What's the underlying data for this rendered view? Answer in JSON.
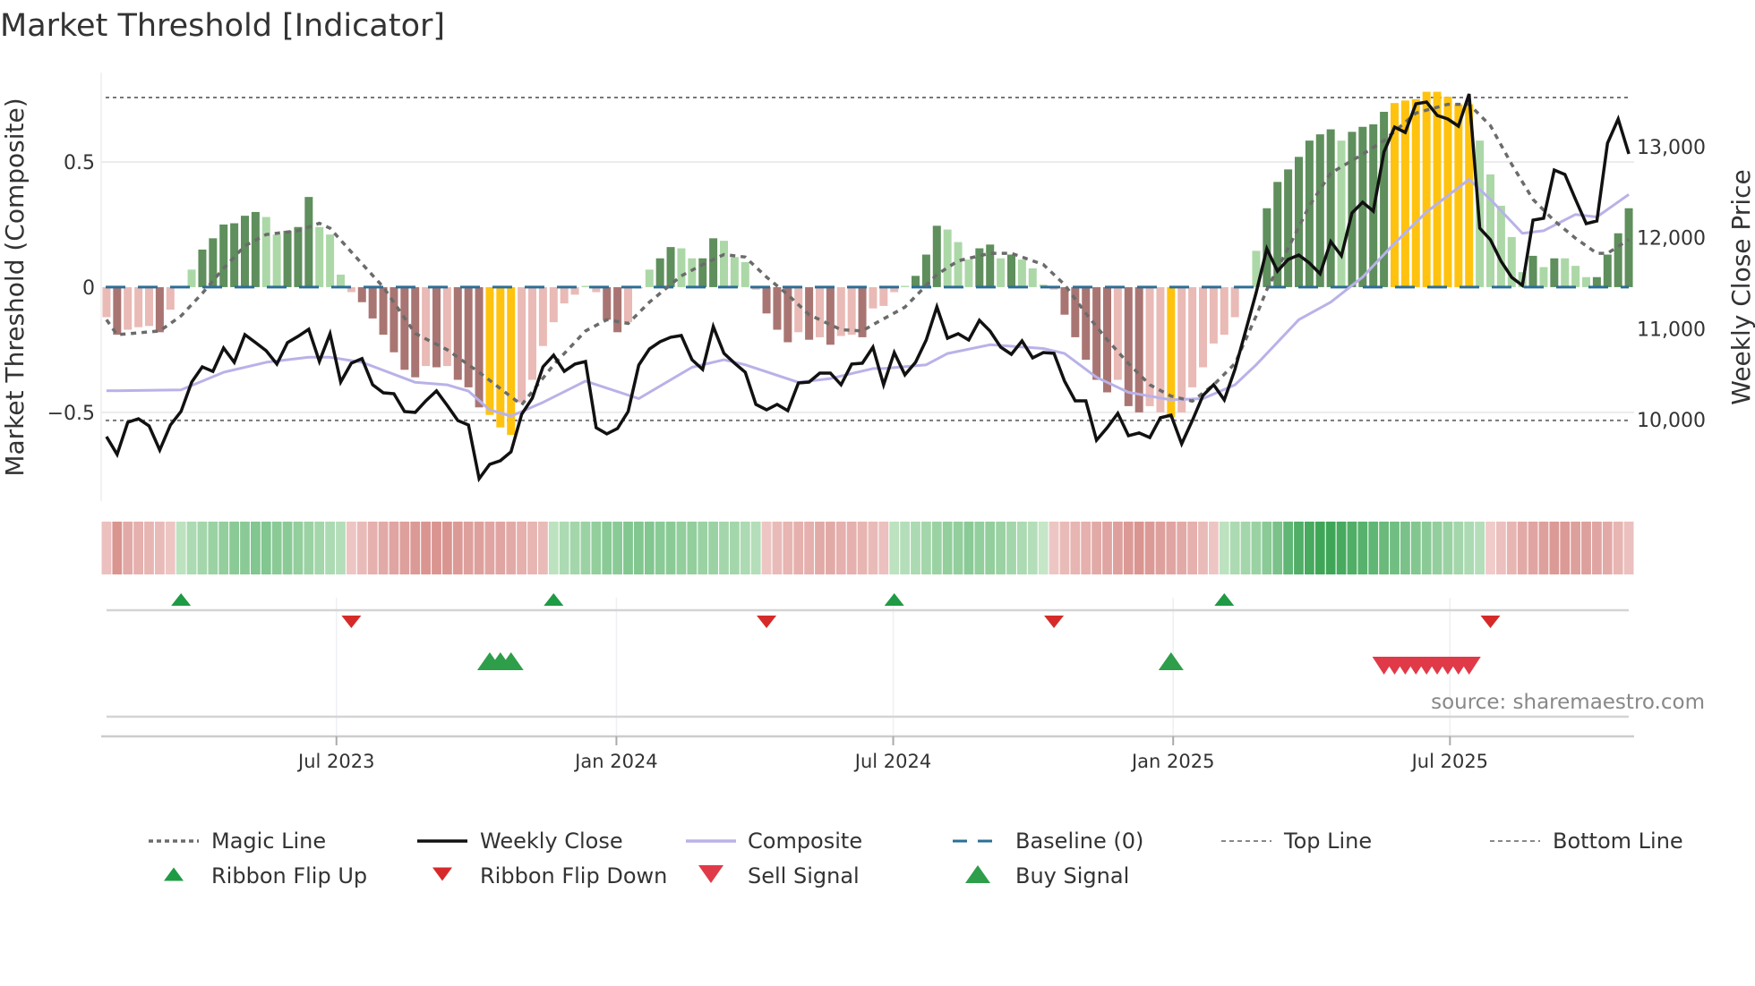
{
  "chart_data": {
    "type": "bar",
    "title": "Market Threshold [Indicator]",
    "ylabel": "Market Threshold (Composite)",
    "ylabel_right": "Weekly Close Price",
    "ylim": [
      -0.854,
      0.857
    ],
    "ylim_right": [
      9105,
      13815
    ],
    "xlim_weeks": [
      -0.5,
      143.5
    ],
    "top_line": 0.757,
    "bottom_line": -0.532,
    "baseline": 0,
    "yticks": [
      {
        "label": "0.5",
        "value": 0.5
      },
      {
        "label": "0",
        "value": 0
      },
      {
        "label": "−0.5",
        "value": -0.5
      }
    ],
    "yticks_right": [
      {
        "label": "13,000",
        "value": 13000
      },
      {
        "label": "12,000",
        "value": 12000
      },
      {
        "label": "11,000",
        "value": 11000
      },
      {
        "label": "10,000",
        "value": 10000
      }
    ],
    "xticks": [
      {
        "label": "Jul 2023",
        "week": 21.6
      },
      {
        "label": "Jan 2024",
        "week": 47.9
      },
      {
        "label": "Jul 2024",
        "week": 73.9
      },
      {
        "label": "Jan 2025",
        "week": 100.2
      },
      {
        "label": "Jul 2025",
        "week": 126.2
      }
    ],
    "colors": {
      "DG": "#5e8f5c",
      "LG": "#acd8a7",
      "DR": "#a97572",
      "LR": "#e9bab6",
      "Y": "#ffc30f",
      "close": "#111111",
      "composite": "#b9b2e8",
      "magic": "#6b6b6b",
      "baseline": "#2b6f96",
      "topbottom": "#777777",
      "flip_up": "#1f9a45",
      "flip_down": "#d62a2a",
      "sell": "#e03a48",
      "buy": "#2e9e4a"
    },
    "composite_bars": [
      -0.12,
      -0.19,
      -0.17,
      -0.16,
      -0.155,
      -0.18,
      -0.09,
      0.005,
      0.07,
      0.15,
      0.195,
      0.25,
      0.255,
      0.285,
      0.3,
      0.28,
      0.21,
      0.225,
      0.24,
      0.36,
      0.24,
      0.21,
      0.05,
      -0.02,
      -0.06,
      -0.125,
      -0.19,
      -0.26,
      -0.33,
      -0.36,
      -0.315,
      -0.32,
      -0.315,
      -0.37,
      -0.4,
      -0.48,
      -0.51,
      -0.56,
      -0.59,
      -0.46,
      -0.37,
      -0.235,
      -0.14,
      -0.065,
      -0.03,
      0.005,
      -0.02,
      -0.13,
      -0.18,
      -0.14,
      -0.005,
      0.07,
      0.115,
      0.16,
      0.155,
      0.115,
      0.115,
      0.195,
      0.185,
      0.12,
      0.1,
      -0.01,
      -0.105,
      -0.17,
      -0.22,
      -0.18,
      -0.21,
      -0.2,
      -0.23,
      -0.195,
      -0.19,
      -0.2,
      -0.085,
      -0.075,
      -0.02,
      0.005,
      0.045,
      0.13,
      0.245,
      0.23,
      0.18,
      0.11,
      0.155,
      0.17,
      0.115,
      0.13,
      0.11,
      0.075,
      0.01,
      -0.01,
      -0.11,
      -0.2,
      -0.29,
      -0.37,
      -0.42,
      -0.37,
      -0.475,
      -0.5,
      -0.475,
      -0.5,
      -0.52,
      -0.5,
      -0.4,
      -0.32,
      -0.225,
      -0.19,
      -0.12,
      0,
      0.145,
      0.315,
      0.42,
      0.47,
      0.52,
      0.585,
      0.61,
      0.63,
      0.585,
      0.62,
      0.64,
      0.65,
      0.7,
      0.735,
      0.745,
      0.75,
      0.78,
      0.78,
      0.76,
      0.73,
      0.73,
      0.585,
      0.45,
      0.325,
      0.2,
      0.06,
      0.125,
      0.08,
      0.115,
      0.115,
      0.085,
      0.04,
      0.04,
      0.13,
      0.215,
      0.315
    ],
    "bar_classes": [
      "LR",
      "DR",
      "LR",
      "LR",
      "LR",
      "DR",
      "LR",
      "LG",
      "LG",
      "DG",
      "DG",
      "DG",
      "DG",
      "DG",
      "DG",
      "LG",
      "LG",
      "DG",
      "DG",
      "DG",
      "LG",
      "LG",
      "LG",
      "LR",
      "DR",
      "DR",
      "DR",
      "DR",
      "DR",
      "DR",
      "LR",
      "DR",
      "LR",
      "DR",
      "DR",
      "DR",
      "Y",
      "Y",
      "Y",
      "LR",
      "LR",
      "LR",
      "LR",
      "LR",
      "LR",
      "LG",
      "LR",
      "DR",
      "DR",
      "LR",
      "LR",
      "LG",
      "DG",
      "DG",
      "LG",
      "LG",
      "DG",
      "DG",
      "LG",
      "LG",
      "LG",
      "LR",
      "DR",
      "DR",
      "DR",
      "LR",
      "DR",
      "LR",
      "DR",
      "LR",
      "LR",
      "DR",
      "LR",
      "LR",
      "LR",
      "LG",
      "DG",
      "DG",
      "DG",
      "LG",
      "LG",
      "LG",
      "DG",
      "DG",
      "LG",
      "DG",
      "LG",
      "LG",
      "LG",
      "LR",
      "DR",
      "DR",
      "DR",
      "DR",
      "DR",
      "LR",
      "DR",
      "DR",
      "LR",
      "LR",
      "Y",
      "LR",
      "LR",
      "LR",
      "LR",
      "LR",
      "LR",
      "LG",
      "LG",
      "DG",
      "DG",
      "DG",
      "DG",
      "DG",
      "DG",
      "DG",
      "LG",
      "DG",
      "DG",
      "DG",
      "DG",
      "Y",
      "Y",
      "Y",
      "Y",
      "Y",
      "Y",
      "Y",
      "Y",
      "LG",
      "LG",
      "LG",
      "LG",
      "LG",
      "DG",
      "LG",
      "DG",
      "LG",
      "LG",
      "LG",
      "DG",
      "DG",
      "DG",
      "DG"
    ],
    "weekly_close": [
      9813,
      9617,
      9970,
      10010,
      9930,
      9665,
      9940,
      10090,
      10413,
      10580,
      10530,
      10787,
      10630,
      10934,
      10846,
      10757,
      10610,
      10846,
      10915,
      10993,
      10640,
      10944,
      10413,
      10620,
      10670,
      10383,
      10295,
      10285,
      10088,
      10079,
      10206,
      10315,
      10157,
      9990,
      9941,
      9351,
      9508,
      9548,
      9646,
      10059,
      10236,
      10580,
      10708,
      10531,
      10610,
      10639,
      9911,
      9843,
      9902,
      10088,
      10600,
      10777,
      10856,
      10905,
      10924,
      10659,
      10551,
      11022,
      10728,
      10620,
      10521,
      10167,
      10108,
      10167,
      10098,
      10403,
      10413,
      10511,
      10511,
      10383,
      10610,
      10620,
      10796,
      10383,
      10737,
      10492,
      10630,
      10875,
      11239,
      10895,
      10944,
      10875,
      11091,
      10973,
      10796,
      10718,
      10865,
      10678,
      10737,
      10728,
      10423,
      10206,
      10206,
      9774,
      9911,
      10069,
      9823,
      9853,
      9803,
      10020,
      10049,
      9734,
      9990,
      10265,
      10383,
      10216,
      10551,
      10973,
      11396,
      11878,
      11632,
      11760,
      11809,
      11721,
      11603,
      11957,
      11800,
      12271,
      12389,
      12291,
      12940,
      13215,
      13156,
      13471,
      13491,
      13343,
      13304,
      13225,
      13579,
      12104,
      11976,
      11740,
      11563,
      11475,
      12193,
      12212,
      12743,
      12694,
      12419,
      12154,
      12183,
      13038,
      13304,
      12920
    ],
    "composite_line": [
      [
        0,
        -0.414
      ],
      [
        7,
        -0.41
      ],
      [
        11,
        -0.34
      ],
      [
        15,
        -0.3
      ],
      [
        19,
        -0.28
      ],
      [
        21,
        -0.28
      ],
      [
        24,
        -0.3
      ],
      [
        29,
        -0.38
      ],
      [
        32,
        -0.39
      ],
      [
        34,
        -0.415
      ],
      [
        36,
        -0.49
      ],
      [
        38,
        -0.515
      ],
      [
        41,
        -0.46
      ],
      [
        45,
        -0.375
      ],
      [
        50,
        -0.445
      ],
      [
        55,
        -0.32
      ],
      [
        58,
        -0.29
      ],
      [
        60,
        -0.31
      ],
      [
        65,
        -0.38
      ],
      [
        68,
        -0.365
      ],
      [
        72,
        -0.325
      ],
      [
        73,
        -0.325
      ],
      [
        77,
        -0.31
      ],
      [
        79,
        -0.265
      ],
      [
        83,
        -0.23
      ],
      [
        88,
        -0.245
      ],
      [
        90,
        -0.265
      ],
      [
        93,
        -0.36
      ],
      [
        96,
        -0.42
      ],
      [
        100,
        -0.45
      ],
      [
        103,
        -0.445
      ],
      [
        106,
        -0.39
      ],
      [
        108,
        -0.31
      ],
      [
        109,
        -0.265
      ],
      [
        112,
        -0.13
      ],
      [
        115,
        -0.06
      ],
      [
        118,
        0.04
      ],
      [
        121,
        0.175
      ],
      [
        124,
        0.3
      ],
      [
        128,
        0.43
      ],
      [
        130,
        0.35
      ],
      [
        133,
        0.215
      ],
      [
        135,
        0.225
      ],
      [
        138,
        0.29
      ],
      [
        140,
        0.28
      ],
      [
        143,
        0.37
      ]
    ],
    "magic_line": [
      [
        0,
        -0.13
      ],
      [
        1,
        -0.19
      ],
      [
        5,
        -0.175
      ],
      [
        7,
        -0.115
      ],
      [
        9,
        -0.025
      ],
      [
        11,
        0.075
      ],
      [
        13,
        0.165
      ],
      [
        15,
        0.21
      ],
      [
        18,
        0.225
      ],
      [
        20,
        0.255
      ],
      [
        21,
        0.235
      ],
      [
        23,
        0.14
      ],
      [
        26,
        0
      ],
      [
        29,
        -0.185
      ],
      [
        32,
        -0.25
      ],
      [
        35,
        -0.34
      ],
      [
        39,
        -0.47
      ],
      [
        42,
        -0.31
      ],
      [
        45,
        -0.175
      ],
      [
        47,
        -0.13
      ],
      [
        49,
        -0.145
      ],
      [
        51,
        -0.06
      ],
      [
        54,
        0.045
      ],
      [
        56,
        0.09
      ],
      [
        58,
        0.13
      ],
      [
        60,
        0.12
      ],
      [
        62,
        0.04
      ],
      [
        64,
        -0.03
      ],
      [
        66,
        -0.11
      ],
      [
        69,
        -0.17
      ],
      [
        71,
        -0.175
      ],
      [
        72,
        -0.15
      ],
      [
        75,
        -0.08
      ],
      [
        78,
        0.05
      ],
      [
        80,
        0.105
      ],
      [
        83,
        0.135
      ],
      [
        85,
        0.135
      ],
      [
        88,
        0.09
      ],
      [
        90,
        0.01
      ],
      [
        92,
        -0.105
      ],
      [
        94,
        -0.21
      ],
      [
        96,
        -0.305
      ],
      [
        98,
        -0.39
      ],
      [
        100,
        -0.435
      ],
      [
        102,
        -0.455
      ],
      [
        104,
        -0.39
      ],
      [
        106,
        -0.305
      ],
      [
        108,
        -0.115
      ],
      [
        109,
        -0.01
      ],
      [
        111,
        0.155
      ],
      [
        113,
        0.325
      ],
      [
        115,
        0.455
      ],
      [
        118,
        0.53
      ],
      [
        120,
        0.585
      ],
      [
        123,
        0.695
      ],
      [
        126,
        0.73
      ],
      [
        128,
        0.73
      ],
      [
        130,
        0.645
      ],
      [
        132,
        0.49
      ],
      [
        134,
        0.35
      ],
      [
        136,
        0.265
      ],
      [
        138,
        0.195
      ],
      [
        140,
        0.135
      ],
      [
        141,
        0.135
      ],
      [
        143,
        0.19
      ]
    ],
    "ribbon": [
      -0.2,
      -0.6,
      -0.4,
      -0.35,
      -0.3,
      -0.25,
      -0.15,
      0.15,
      0.25,
      0.3,
      0.35,
      0.4,
      0.45,
      0.45,
      0.5,
      0.5,
      0.45,
      0.45,
      0.4,
      0.35,
      0.3,
      0.25,
      0.2,
      -0.15,
      -0.25,
      -0.35,
      -0.4,
      -0.45,
      -0.5,
      -0.55,
      -0.6,
      -0.6,
      -0.6,
      -0.55,
      -0.5,
      -0.5,
      -0.45,
      -0.45,
      -0.4,
      -0.35,
      -0.3,
      -0.25,
      0.15,
      0.25,
      0.3,
      0.35,
      0.4,
      0.45,
      0.45,
      0.5,
      0.5,
      0.5,
      0.45,
      0.45,
      0.4,
      0.4,
      0.35,
      0.35,
      0.3,
      0.3,
      0.25,
      0.2,
      -0.15,
      -0.25,
      -0.3,
      -0.35,
      -0.35,
      -0.4,
      -0.4,
      -0.35,
      -0.35,
      -0.3,
      -0.25,
      -0.2,
      0.15,
      0.2,
      0.25,
      0.3,
      0.35,
      0.4,
      0.4,
      0.45,
      0.4,
      0.4,
      0.35,
      0.3,
      0.25,
      0.2,
      0.1,
      -0.15,
      -0.25,
      -0.3,
      -0.35,
      -0.4,
      -0.45,
      -0.5,
      -0.55,
      -0.6,
      -0.55,
      -0.5,
      -0.45,
      -0.4,
      -0.35,
      -0.25,
      -0.15,
      0.15,
      0.25,
      0.3,
      0.35,
      0.45,
      0.55,
      0.7,
      0.8,
      0.85,
      0.9,
      0.9,
      0.85,
      0.8,
      0.75,
      0.7,
      0.65,
      0.6,
      0.55,
      0.5,
      0.45,
      0.4,
      0.35,
      0.3,
      0.25,
      0.2,
      -0.1,
      -0.2,
      -0.3,
      -0.4,
      -0.45,
      -0.5,
      -0.55,
      -0.55,
      -0.5,
      -0.5,
      -0.45,
      -0.4,
      -0.3,
      -0.2
    ],
    "signals": {
      "ribbon_flip_up": [
        7,
        42,
        74,
        105
      ],
      "ribbon_flip_down": [
        23,
        62,
        89,
        130
      ],
      "buy": [
        36,
        37,
        38,
        100
      ],
      "sell": [
        120,
        121,
        122,
        123,
        124,
        125,
        126,
        127,
        128
      ]
    },
    "legend": [
      {
        "label": "Magic Line",
        "key": "magic"
      },
      {
        "label": "Weekly Close",
        "key": "close"
      },
      {
        "label": "Composite",
        "key": "composite"
      },
      {
        "label": "Baseline (0)",
        "key": "baseline"
      },
      {
        "label": "Top Line",
        "key": "top"
      },
      {
        "label": "Bottom Line",
        "key": "bottom"
      },
      {
        "label": "Ribbon Flip Up",
        "key": "flip_up"
      },
      {
        "label": "Ribbon Flip Down",
        "key": "flip_down"
      },
      {
        "label": "Sell Signal",
        "key": "sell"
      },
      {
        "label": "Buy Signal",
        "key": "buy"
      }
    ],
    "source": "source: sharemaestro.com"
  }
}
